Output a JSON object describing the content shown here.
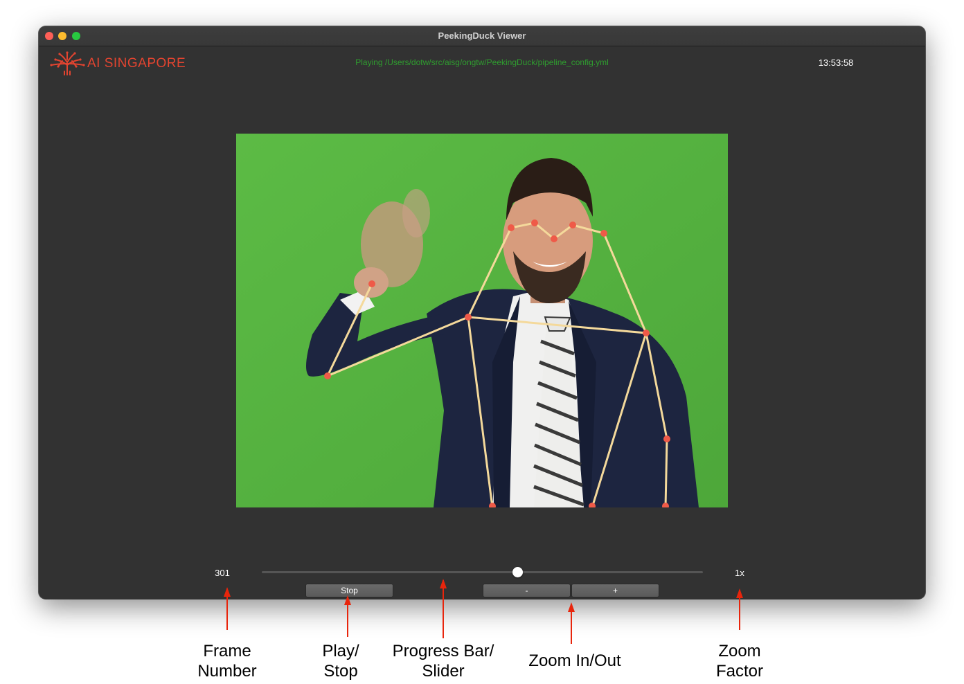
{
  "window": {
    "title": "PeekingDuck Viewer"
  },
  "header": {
    "logo_text": "AI SINGAPORE",
    "status": "Playing /Users/dotw/src/aisg/ongtw/PeekingDuck/pipeline_config.yml",
    "clock": "13:53:58"
  },
  "controls": {
    "frame_number": "301",
    "progress_fraction": 0.58,
    "stop_label": "Stop",
    "zoom_out_label": "-",
    "zoom_in_label": "+",
    "zoom_factor": "1x"
  },
  "annotations": {
    "frame_number": [
      "Frame",
      "Number"
    ],
    "play_stop": [
      "Play/",
      "Stop"
    ],
    "progress_bar": [
      "Progress Bar/",
      "Slider"
    ],
    "zoom_in_out": "Zoom In/Out",
    "zoom_factor": [
      "Zoom",
      "Factor"
    ]
  },
  "colors": {
    "window_bg": "#323232",
    "status_text": "#2f9e2f",
    "logo": "#e24430",
    "annotation_arrow": "#e8250c",
    "keypoint": "#ef5a48",
    "skeleton": "#f4d99b",
    "greenscreen": "#57b440"
  }
}
